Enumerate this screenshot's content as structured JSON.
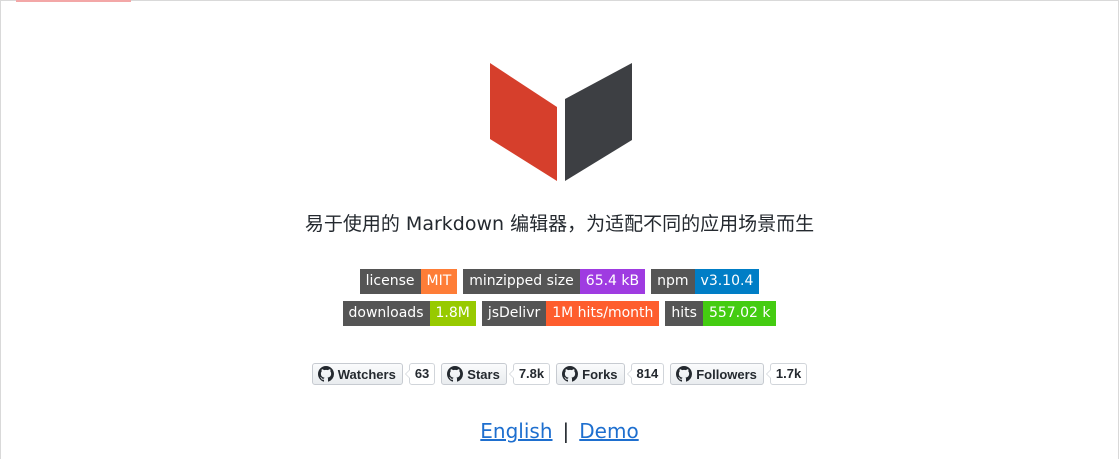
{
  "colors": {
    "logo_left": "#d63f2c",
    "logo_right": "#3d3f43",
    "link": "#1e6fcf"
  },
  "tagline": "易于使用的 Markdown 编辑器，为适配不同的应用场景而生",
  "badges_row1": [
    {
      "label": "license",
      "value": "MIT",
      "color": "#fe7d37"
    },
    {
      "label": "minzipped size",
      "value": "65.4 kB",
      "color": "#9f3be1"
    },
    {
      "label": "npm",
      "value": "v3.10.4",
      "color": "#007ec6"
    }
  ],
  "badges_row2": [
    {
      "label": "downloads",
      "value": "1.8M",
      "color": "#97ca00"
    },
    {
      "label": "jsDelivr",
      "value": "1M hits/month",
      "color": "#fe5d2d"
    },
    {
      "label": "hits",
      "value": "557.02 k",
      "color": "#4c1"
    }
  ],
  "github": [
    {
      "label": "Watchers",
      "count": "63",
      "icon": "github-icon"
    },
    {
      "label": "Stars",
      "count": "7.8k",
      "icon": "github-icon"
    },
    {
      "label": "Forks",
      "count": "814",
      "icon": "github-icon"
    },
    {
      "label": "Followers",
      "count": "1.7k",
      "icon": "github-icon"
    }
  ],
  "links": {
    "english": "English",
    "separator": "|",
    "demo": "Demo"
  }
}
